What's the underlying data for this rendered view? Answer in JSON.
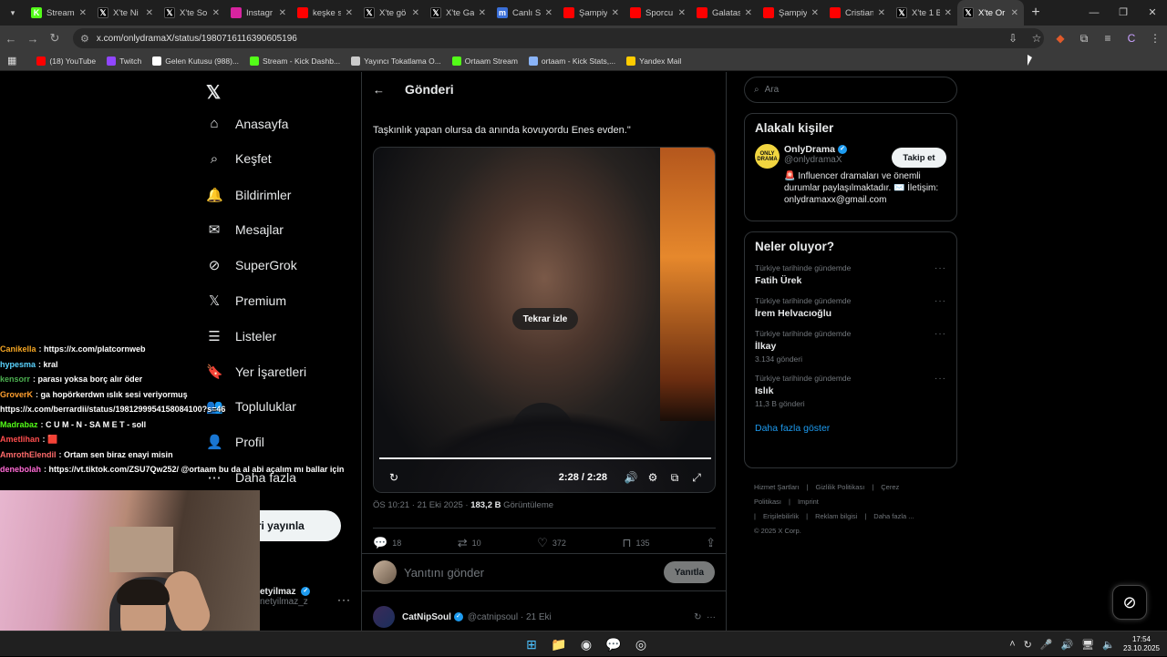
{
  "browser": {
    "tabs": [
      {
        "label": "Stream",
        "icon": "kick-icon",
        "color": "#53fc18"
      },
      {
        "label": "X'te Ni",
        "icon": "x-icon",
        "color": "#000000"
      },
      {
        "label": "X'te So",
        "icon": "x-icon",
        "color": "#000000"
      },
      {
        "label": "Instagr",
        "icon": "instagram-icon",
        "color": "#d6249f"
      },
      {
        "label": "keşke s",
        "icon": "youtube-icon",
        "color": "#ff0000"
      },
      {
        "label": "X'te gö",
        "icon": "x-icon",
        "color": "#000000"
      },
      {
        "label": "X'te Ga",
        "icon": "x-icon",
        "color": "#000000"
      },
      {
        "label": "Canlı S",
        "icon": "m-icon",
        "color": "#3a6fd8"
      },
      {
        "label": "Şampiy",
        "icon": "youtube-icon",
        "color": "#ff0000"
      },
      {
        "label": "Sporcu",
        "icon": "youtube-icon",
        "color": "#ff0000"
      },
      {
        "label": "Galatas",
        "icon": "youtube-icon",
        "color": "#ff0000"
      },
      {
        "label": "Şampiy",
        "icon": "youtube-icon",
        "color": "#ff0000"
      },
      {
        "label": "Cristian",
        "icon": "youtube-icon",
        "color": "#ff0000"
      },
      {
        "label": "X'te 1 B",
        "icon": "x-icon",
        "color": "#000000"
      },
      {
        "label": "X'te Or",
        "icon": "x-icon",
        "color": "#000000",
        "active": true
      }
    ],
    "url": "x.com/onlydramaX/status/1980716116390605196",
    "bookmarks": [
      {
        "label": "(18) YouTube",
        "color": "#ff0000"
      },
      {
        "label": "Twitch",
        "color": "#9146ff"
      },
      {
        "label": "Gelen Kutusu (988)...",
        "color": "#ffffff"
      },
      {
        "label": "Stream - Kick Dashb...",
        "color": "#53fc18"
      },
      {
        "label": "Yayıncı Tokatlama O...",
        "color": "#cccccc"
      },
      {
        "label": "Ortaam Stream",
        "color": "#53fc18"
      },
      {
        "label": "ortaam - Kick Stats,...",
        "color": "#8ab4f8"
      },
      {
        "label": "Yandex Mail",
        "color": "#ffcc00"
      }
    ]
  },
  "sidebar": {
    "items": [
      {
        "label": "Anasayfa",
        "icon": "⌂"
      },
      {
        "label": "Keşfet",
        "icon": "⌕"
      },
      {
        "label": "Bildirimler",
        "icon": "🔔"
      },
      {
        "label": "Mesajlar",
        "icon": "✉"
      },
      {
        "label": "SuperGrok",
        "icon": "⊘"
      },
      {
        "label": "Premium",
        "icon": "𝕏"
      },
      {
        "label": "Listeler",
        "icon": "☰"
      },
      {
        "label": "Yer İşaretleri",
        "icon": "🔖"
      },
      {
        "label": "Topluluklar",
        "icon": "👥"
      },
      {
        "label": "Profil",
        "icon": "👤"
      },
      {
        "label": "Daha fazla",
        "icon": "⋯"
      }
    ],
    "post_button": "eri yayınla",
    "user_name": "etyilmaz",
    "user_handle": "netyilmaz_z"
  },
  "post": {
    "header_title": "Gönderi",
    "quote_text": "Taşkınlık yapan olursa da anında kovuyordu Enes evden.\"",
    "replay_label": "Tekrar izle",
    "video_time": "2:28 / 2:28",
    "progress_fraction": 1.0,
    "timestamp": "ÖS 10:21 · 21 Eki 2025 · ",
    "views_count": "183,2 B",
    "views_label": " Görüntüleme",
    "replies": "18",
    "reposts": "10",
    "likes": "372",
    "bookmarks": "135",
    "reply_placeholder": "Yanıtını gönder",
    "reply_button": "Yanıtla",
    "next_post": {
      "name": "CatNipSoul",
      "handle": "@catnipsoul · 21 Eki"
    }
  },
  "right": {
    "search_placeholder": "Ara",
    "related_title": "Alakalı kişiler",
    "person": {
      "avatar_text": "ONLY DRAMA",
      "name": "OnlyDrama",
      "handle": "@onlydramaX",
      "follow": "Takip et",
      "bio": "🚨 Influencer dramaları ve önemli durumlar paylaşılmaktadır. ✉️ İletişim: onlydramaxx@gmail.com"
    },
    "trends_title": "Neler oluyor?",
    "trends": [
      {
        "context": "Türkiye tarihinde gündemde",
        "name": "Fatih Ürek",
        "posts": ""
      },
      {
        "context": "Türkiye tarihinde gündemde",
        "name": "İrem Helvacıoğlu",
        "posts": ""
      },
      {
        "context": "Türkiye tarihinde gündemde",
        "name": "İlkay",
        "posts": "3.134 gönderi"
      },
      {
        "context": "Türkiye tarihinde gündemde",
        "name": "Islık",
        "posts": "11,3 B gönderi"
      }
    ],
    "show_more": "Daha fazla göster",
    "footer": [
      "Hizmet Şartları",
      "|",
      "Gizlilik Politikası",
      "|",
      "Çerez Politikası",
      "|",
      "Imprint",
      "|",
      "Erişilebilirlik",
      "|",
      "Reklam bilgisi",
      "|",
      "Daha fazla ...",
      "© 2025 X Corp."
    ]
  },
  "chat": [
    {
      "user": "Canikella",
      "color": "#f5a623",
      "text": "https://x.com/platcornweb"
    },
    {
      "user": "hypesma",
      "color": "#5ad4ff",
      "text": "kral"
    },
    {
      "user": "kensorr",
      "color": "#4caf50",
      "text": "parası yoksa borç alır öder"
    },
    {
      "user": "GroverK",
      "color": "#ff9f2f",
      "text": "ga hopörkerdwn ıslık sesi veriyormuş https://x.com/berrardii/status/1981299954158084100?s=46"
    },
    {
      "user": "Madrabaz",
      "color": "#53fc18",
      "text": "C U M - N - SA M E T - soll"
    },
    {
      "user": "Ametlihan",
      "color": "#ff4d4d",
      "text": "🟥"
    },
    {
      "user": "AmrothElendil",
      "color": "#ff6b6b",
      "text": "Ortam sen biraz enayi misin"
    },
    {
      "user": "denebolah",
      "color": "#ff6ad5",
      "text": "https://vt.tiktok.com/ZSU7Qw252/ @ortaam bu da al abi açalım mı ballar için"
    }
  ],
  "taskbar": {
    "apps": [
      "⊞",
      "📁",
      "◉",
      "💬",
      "◎"
    ],
    "time": "17:54",
    "date": "23.10.2025"
  }
}
